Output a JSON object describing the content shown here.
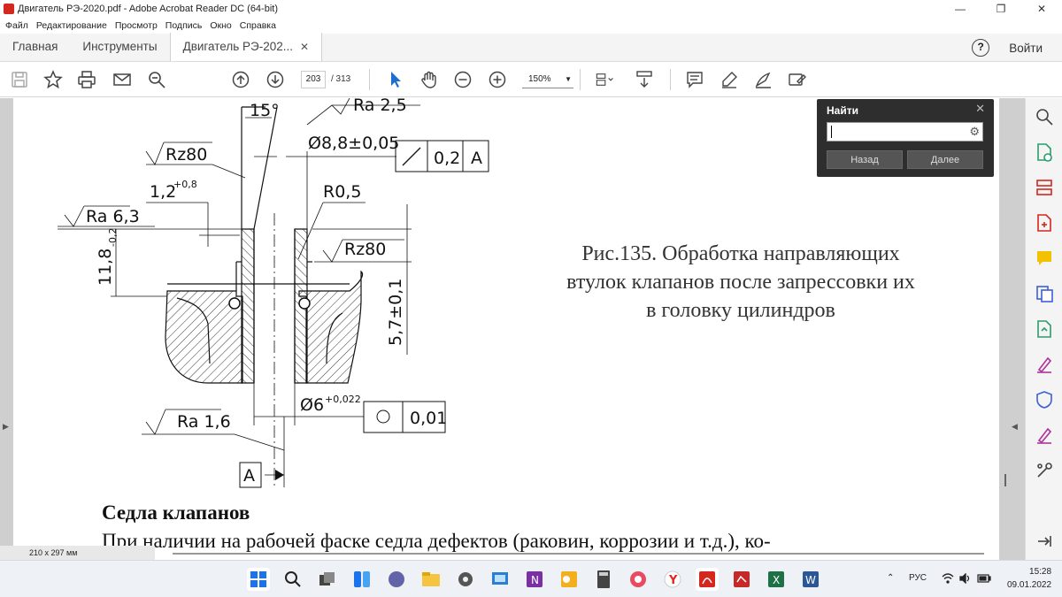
{
  "window": {
    "title": "Двигатель РЭ-2020.pdf - Adobe Acrobat Reader DC (64-bit)",
    "minimize": "—",
    "maximize": "❐",
    "close": "✕"
  },
  "menu": [
    "Файл",
    "Редактирование",
    "Просмотр",
    "Подпись",
    "Окно",
    "Справка"
  ],
  "tabs": {
    "home": "Главная",
    "tools": "Инструменты",
    "document": "Двигатель РЭ-202...",
    "close": "✕"
  },
  "header_right": {
    "help": "?",
    "signin": "Войти"
  },
  "toolbar": {
    "page_current": "203",
    "page_total": "/  313",
    "zoom": "150%",
    "zoom_caret": "▼"
  },
  "find": {
    "label": "Найти",
    "close": "✕",
    "gear": "⚙",
    "value": "",
    "back": "Назад",
    "next": "Далее"
  },
  "drawing": {
    "angle": "15°",
    "ra25": "Ra 2,5",
    "dia88": "Ø8,8±0,05",
    "tol02": "0,2",
    "datumA": "A",
    "rz80a": "Rz80",
    "dim12": "1,2",
    "dim12sup": "+0,8",
    "r05": "R0,5",
    "ra63": "Ra 6,3",
    "rz80b": "Rz80",
    "dim118": "11,8",
    "dim118sub": "-0,2",
    "dim57": "5,7±0,1",
    "dia6": "Ø6",
    "dia6sup": "+0,022",
    "tol001": "0,01",
    "ra16": "Ra 1,6",
    "datumA2": "A"
  },
  "caption": {
    "line1": "Рис.135. Обработка направляющих",
    "line2": "втулок клапанов после запрессовки их",
    "line3": "в головку цилиндров"
  },
  "section_title": "Седла клапанов",
  "body_text": "При наличии на рабочей фаске седла дефектов (раковин, коррозии и т.д.), ко-",
  "page_size": "210 x 297 мм",
  "taskbar": {
    "lang": "РУС",
    "time": "15:28",
    "date": "09.01.2022",
    "icons": [
      "windows-start",
      "search",
      "task-view",
      "widgets",
      "teams-chat",
      "file-explorer",
      "settings",
      "snipping",
      "onenote",
      "outlook",
      "calculator",
      "media",
      "yandex-browser",
      "acrobat",
      "app-red",
      "excel",
      "word"
    ]
  },
  "colors": {
    "acrobat_red": "#d4271e",
    "find_panel": "#2e2e2e",
    "taskbar": "#eef1f6"
  }
}
